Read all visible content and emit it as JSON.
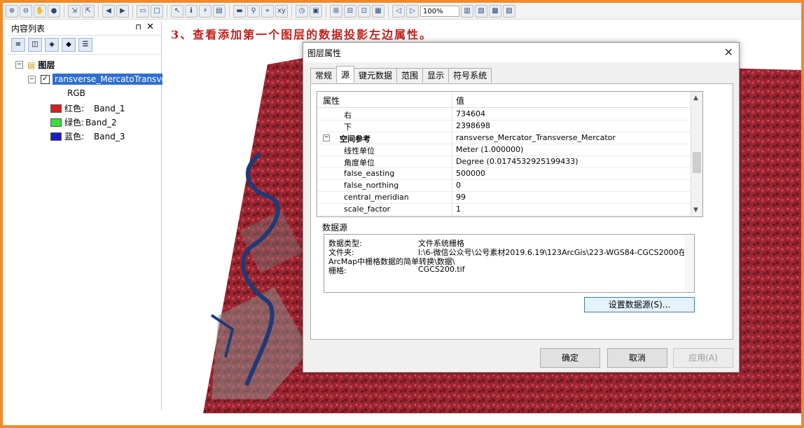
{
  "toolbar": {
    "zoom_value": "100%"
  },
  "toc": {
    "title": "内容列表",
    "pin_icon": "⊓",
    "close_icon": "✕",
    "root_label": "图层",
    "layer_name": "ransverse_MercatoTransverse",
    "render_label": "RGB",
    "bands": [
      {
        "label": "红色:",
        "band": "Band_1",
        "color": "#d42020"
      },
      {
        "label": "绿色:",
        "band": "Band_2",
        "color": "#3cdc3c"
      },
      {
        "label": "蓝色:",
        "band": "Band_3",
        "color": "#1c1cc8"
      }
    ]
  },
  "map": {
    "caption": "3、查看添加第一个图层的数据投影左边属性。"
  },
  "dialog": {
    "title": "图层属性",
    "tabs": [
      "常规",
      "源",
      "键元数据",
      "范围",
      "显示",
      "符号系统"
    ],
    "active_tab": "源",
    "grid_header": {
      "key": "属性",
      "value": "值"
    },
    "rows": [
      {
        "key": "右",
        "value": "734604"
      },
      {
        "key": "下",
        "value": "2398698"
      },
      {
        "key": "空间参考",
        "value": "ransverse_Mercator_Transverse_Mercator",
        "group": true
      },
      {
        "key": "线性单位",
        "value": "Meter (1.000000)"
      },
      {
        "key": "角度单位",
        "value": "Degree (0.0174532925199433)"
      },
      {
        "key": "false_easting",
        "value": "500000"
      },
      {
        "key": "false_northing",
        "value": "0"
      },
      {
        "key": "central_meridian",
        "value": "99"
      },
      {
        "key": "scale_factor",
        "value": "1"
      }
    ],
    "datasource_label": "数据源",
    "datasource": {
      "type_label": "数据类型:",
      "type_value": "文件系统栅格",
      "folder_label": "文件夹:",
      "folder_value": "I:\\6-微信公众号\\公号素材2019.6.19\\123ArcGis\\223-WGS84-CGCS2000在",
      "folder_value_cont": "ArcMap中栅格数据的简单转换\\数据\\",
      "raster_label": "栅格:",
      "raster_value": "CGCS200.tif"
    },
    "set_source_button": "设置数据源(S)...",
    "ok_button": "确定",
    "cancel_button": "取消",
    "apply_button": "应用(A)"
  }
}
